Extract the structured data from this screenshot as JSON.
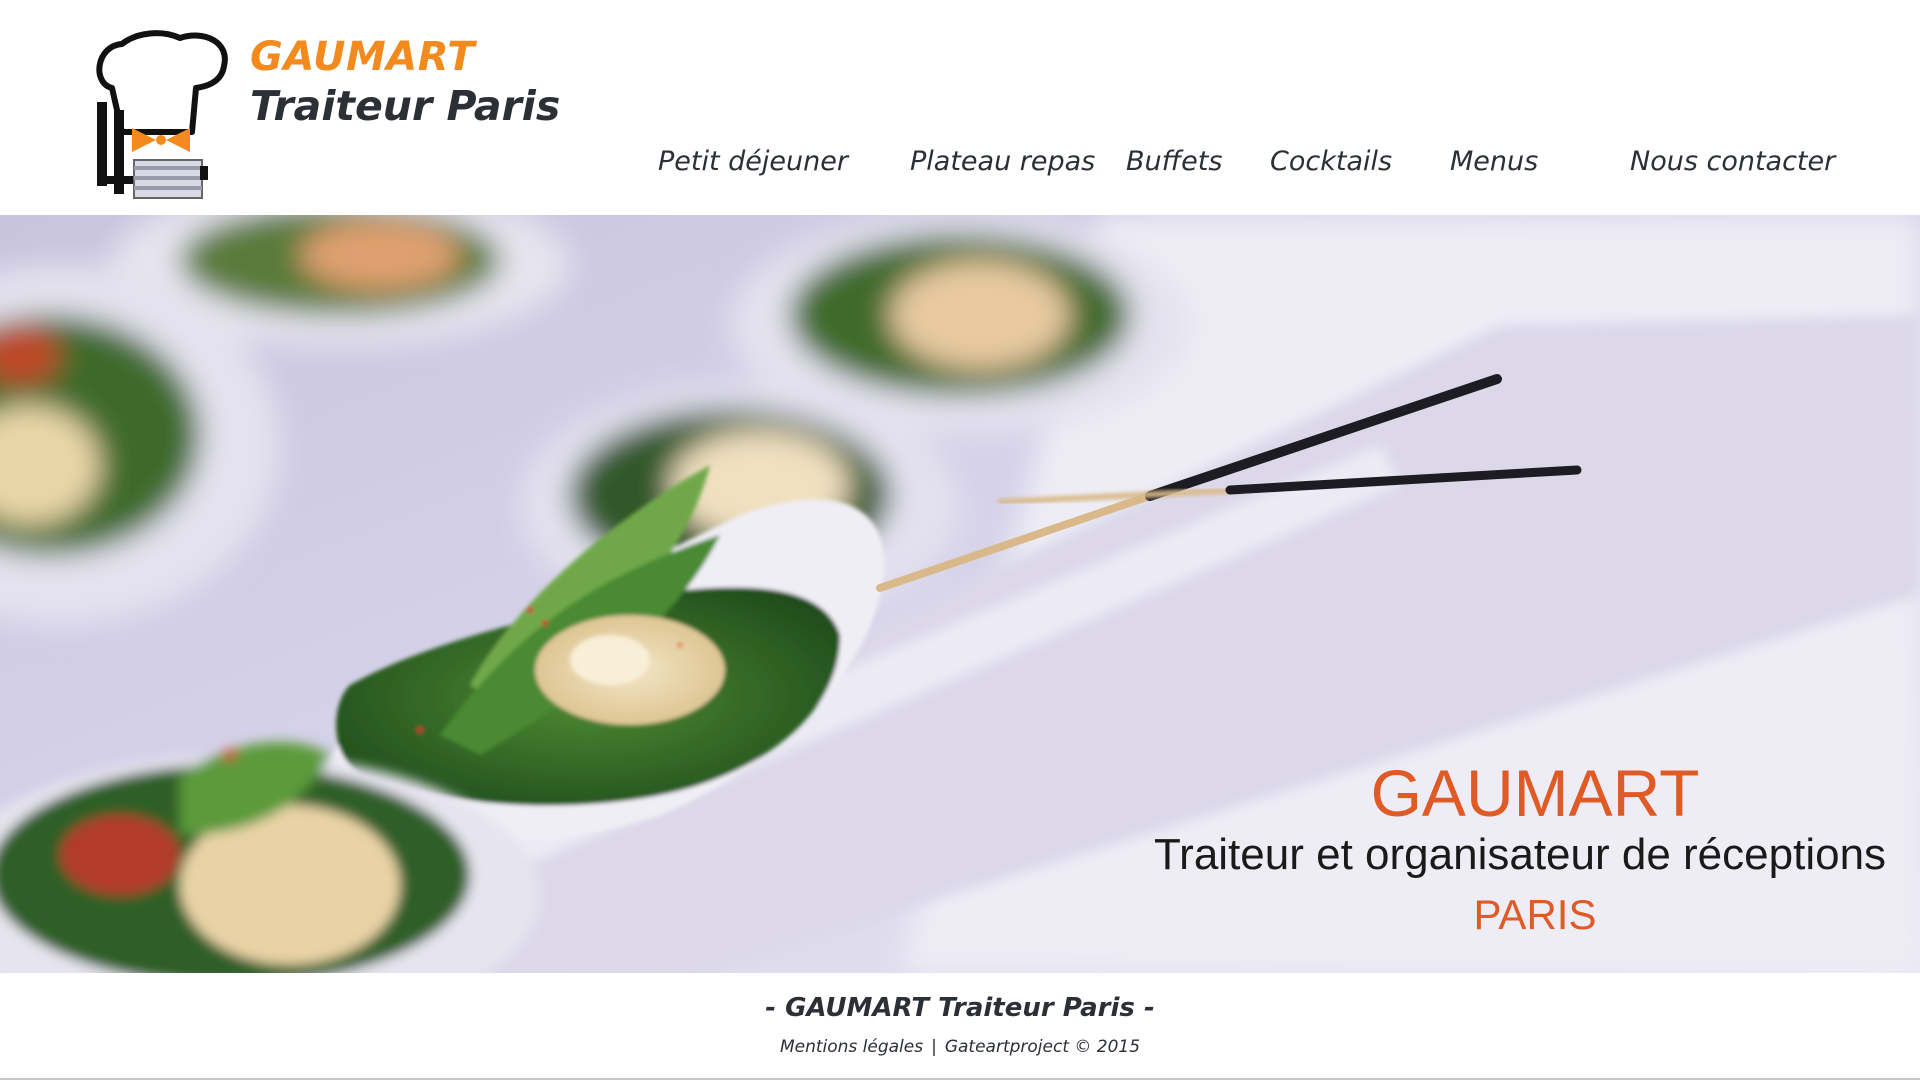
{
  "brand": {
    "name": "GAUMART",
    "subtitle": "Traiteur Paris",
    "accent_color": "#f28a1e",
    "text_color": "#2b2f36"
  },
  "nav": {
    "items": [
      {
        "label": "Petit déjeuner"
      },
      {
        "label": "Plateau repas"
      },
      {
        "label": "Buffets"
      },
      {
        "label": "Cocktails"
      },
      {
        "label": "Menus"
      },
      {
        "label": "Nous contacter"
      }
    ]
  },
  "hero": {
    "title": "GAUMART",
    "subtitle": "Traiteur et organisateur de réceptions",
    "city": "PARIS",
    "title_color": "#e05a26"
  },
  "footer": {
    "title": "- GAUMART Traiteur Paris -",
    "legal_link": "Mentions légales",
    "separator": "|",
    "credit": "Gateartproject © 2015"
  },
  "icons": {
    "logo": "chef-hat-logo-icon"
  }
}
